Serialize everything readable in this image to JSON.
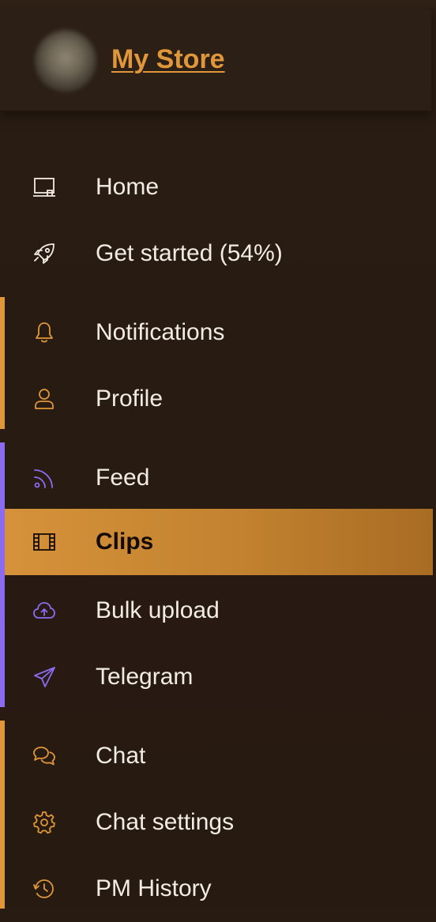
{
  "store": {
    "name": "My Store"
  },
  "colors": {
    "background": "#281b12",
    "accent_orange": "#e0973a",
    "accent_purple": "#8b6cf0",
    "active_bg": "#d6923a",
    "text": "#f3ece4"
  },
  "nav": {
    "home": {
      "label": "Home",
      "icon": "home-icon"
    },
    "get_started": {
      "label": "Get started (54%)",
      "icon": "rocket-icon"
    },
    "notifications": {
      "label": "Notifications",
      "icon": "bell-icon"
    },
    "profile": {
      "label": "Profile",
      "icon": "user-icon"
    },
    "feed": {
      "label": "Feed",
      "icon": "rss-icon"
    },
    "clips": {
      "label": "Clips",
      "icon": "film-icon",
      "active": true
    },
    "bulk_upload": {
      "label": "Bulk upload",
      "icon": "cloud-upload-icon"
    },
    "telegram": {
      "label": "Telegram",
      "icon": "paper-plane-icon"
    },
    "chat": {
      "label": "Chat",
      "icon": "chat-bubbles-icon"
    },
    "chat_settings": {
      "label": "Chat settings",
      "icon": "gear-icon"
    },
    "pm_history": {
      "label": "PM History",
      "icon": "history-icon"
    }
  }
}
